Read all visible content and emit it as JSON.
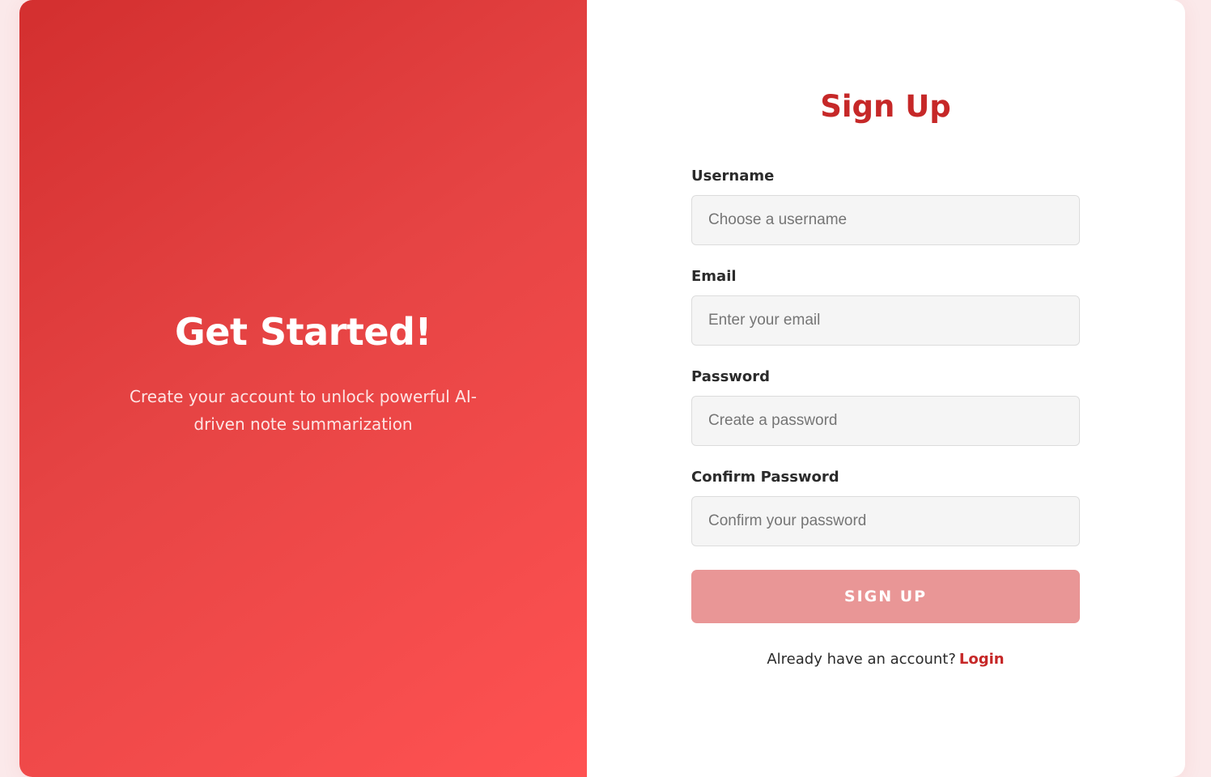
{
  "colors": {
    "accent": "#c62828",
    "gradient_start": "#d32f2f",
    "gradient_end": "#ff5252",
    "button_bg": "#e99696",
    "page_bg": "#fbe9ea"
  },
  "hero": {
    "title": "Get Started!",
    "subtitle": "Create your account to unlock powerful AI-driven note summarization"
  },
  "form": {
    "title": "Sign Up",
    "fields": [
      {
        "label": "Username",
        "placeholder": "Choose a username",
        "value": ""
      },
      {
        "label": "Email",
        "placeholder": "Enter your email",
        "value": ""
      },
      {
        "label": "Password",
        "placeholder": "Create a password",
        "value": ""
      },
      {
        "label": "Confirm Password",
        "placeholder": "Confirm your password",
        "value": ""
      }
    ],
    "submit_label": "SIGN UP",
    "footer_text": "Already have an account?",
    "login_link": "Login"
  }
}
